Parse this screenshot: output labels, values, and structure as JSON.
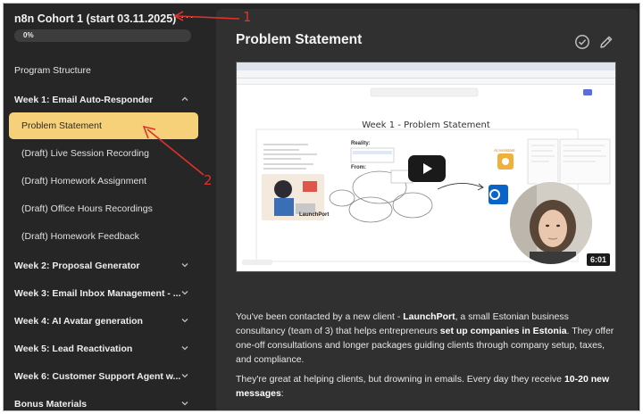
{
  "sidebar": {
    "course_title": "n8n Cohort 1 (start 03.11.2025)",
    "more_label": "···",
    "progress_label": "0%",
    "progress_fraction": 0.0,
    "section_label": "Program Structure",
    "week1": {
      "label": "Week 1: Email Auto-Responder",
      "lessons": [
        "Problem Statement",
        "(Draft) Live Session Recording",
        "(Draft) Homework Assignment",
        "(Draft) Office Hours Recordings",
        "(Draft) Homework Feedback"
      ]
    },
    "weeks": [
      "Week 2: Proposal Generator",
      "Week 3: Email Inbox Management - ...",
      "Week 4: AI Avatar generation",
      "Week 5: Lead Reactivation",
      "Week 6: Customer Support Agent w...",
      "Bonus Materials"
    ]
  },
  "main": {
    "title": "Problem Statement",
    "video": {
      "slide_title": "Week 1 - Problem Statement",
      "slide_small": {
        "reality": "Reality:",
        "from": "From:",
        "launchport": "LaunchPort",
        "ai_assistant": "AI Assistant"
      },
      "duration": "6:01"
    },
    "paragraph1": {
      "t1": "You've been contacted by a new client - ",
      "b1": "LaunchPort",
      "t2": ", a small Estonian business consultancy (team of 3) that helps entrepreneurs ",
      "b2": "set up companies in Estonia",
      "t3": ". They offer one-off consultations and longer packages guiding clients through company setup, taxes, and compliance."
    },
    "paragraph2": {
      "t1": "They're great at helping clients, but drowning in emails. Every day they receive ",
      "b1": "10-20 new messages",
      "t2": ":"
    }
  },
  "annotations": {
    "label1": "1",
    "label2": "2"
  },
  "colors": {
    "active_lesson": "#f6d17a",
    "sidebar_bg": "#262626",
    "main_bg": "#303030",
    "annotation": "#e0302a"
  }
}
